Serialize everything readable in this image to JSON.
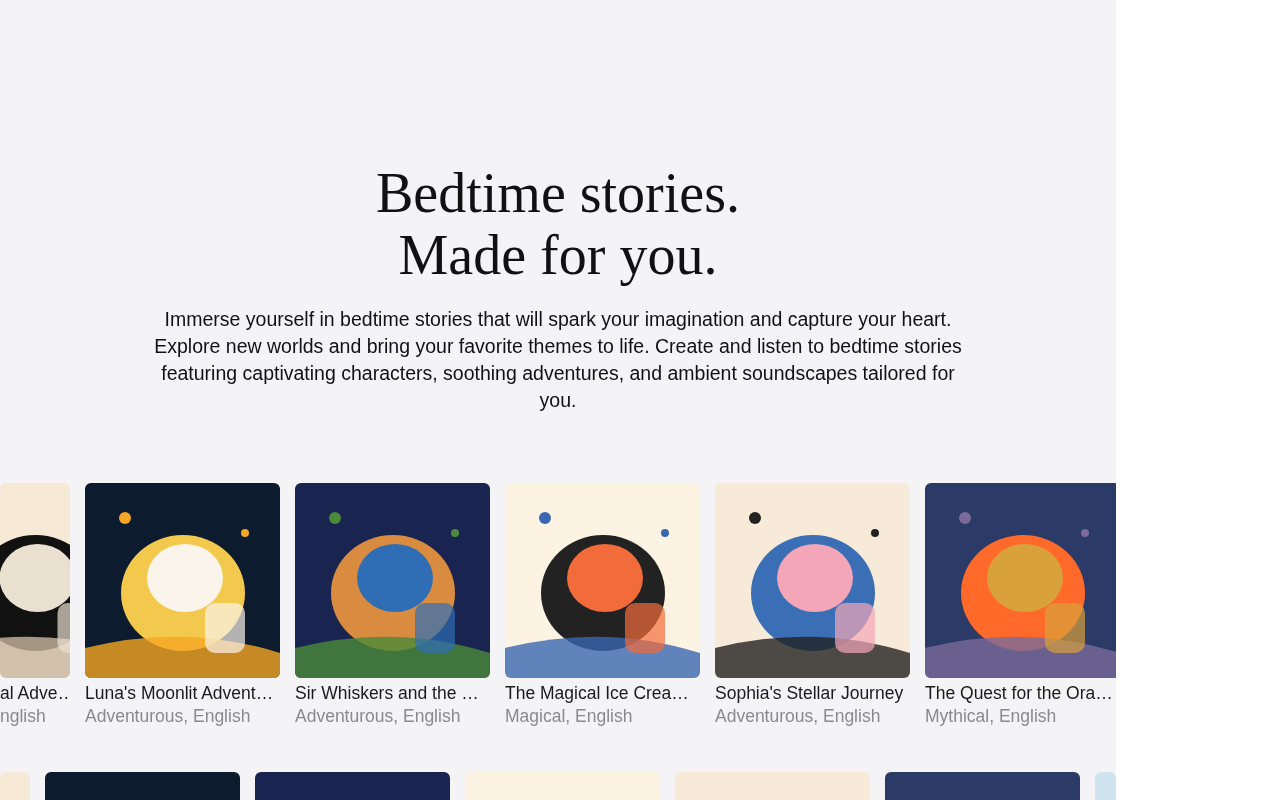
{
  "hero": {
    "title_lines": [
      "Bedtime stories.",
      "Made for you."
    ],
    "description": "Immerse yourself in bedtime stories that will spark your imagination and capture your heart. Explore new worlds and bring your favorite themes to life. Create and listen to bedtime stories featuring captivating characters, soothing adventures, and ambient soundscapes tailored for you."
  },
  "stories": [
    {
      "title": "al Adve…",
      "meta": "nglish",
      "cut": true
    },
    {
      "title": "Luna's Moonlit Advent…",
      "meta": "Adventurous, English",
      "cut": false
    },
    {
      "title": "Sir Whiskers and the …",
      "meta": "Adventurous, English",
      "cut": false
    },
    {
      "title": "The Magical Ice Crea…",
      "meta": "Magical, English",
      "cut": false
    },
    {
      "title": "Sophia's Stellar Journey",
      "meta": "Adventurous, English",
      "cut": false
    },
    {
      "title": "The Quest for the Ora…",
      "meta": "Mythical, English",
      "cut": false
    }
  ],
  "more_stories": [
    {
      "kind": "picture",
      "cut": true
    },
    {
      "kind": "picture",
      "cut": false
    },
    {
      "kind": "picture",
      "cut": false
    },
    {
      "kind": "picture",
      "cut": false
    },
    {
      "kind": "picture",
      "cut": false
    },
    {
      "kind": "picture",
      "cut": false
    },
    {
      "kind": "picture",
      "cut": true
    }
  ]
}
